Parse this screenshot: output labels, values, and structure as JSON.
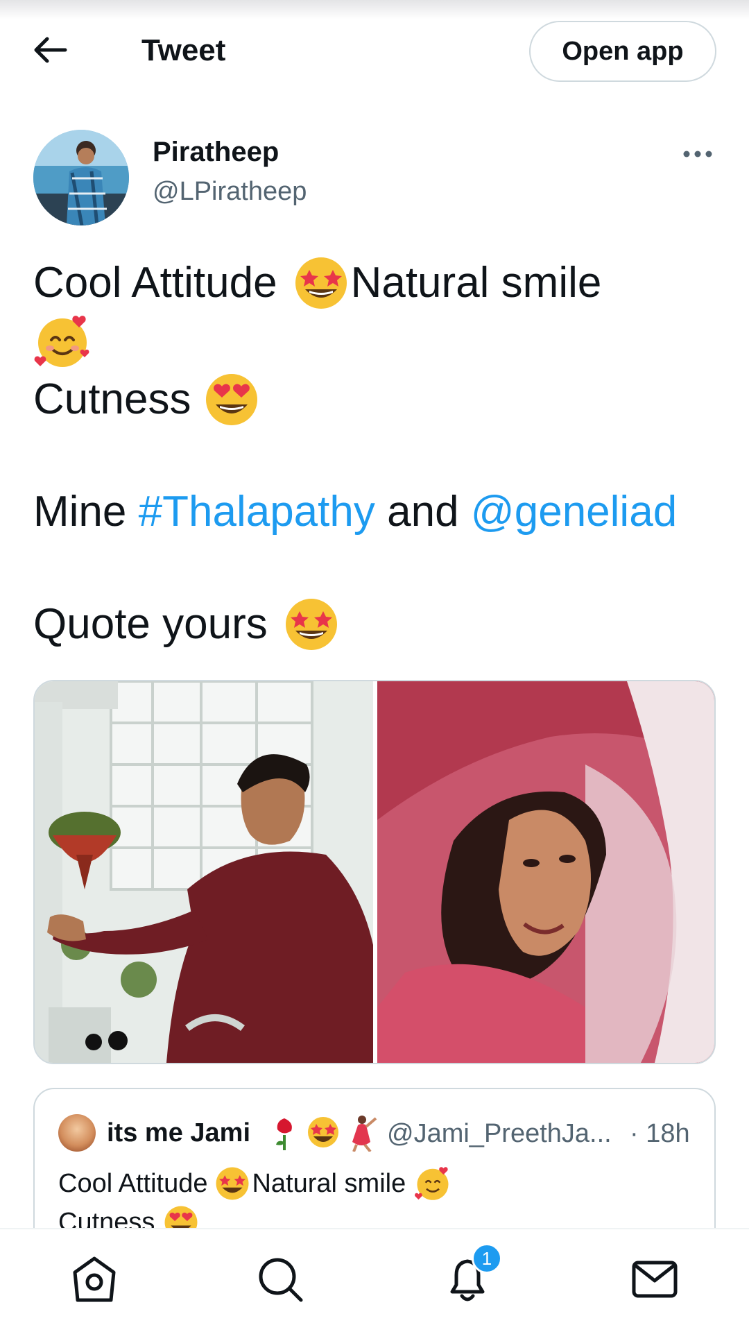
{
  "header": {
    "title": "Tweet",
    "open_app_label": "Open app"
  },
  "author": {
    "name": "Piratheep",
    "handle": "@LPiratheep"
  },
  "tweet": {
    "line1_a": "Cool Attitude",
    "line1_b": "Natural smile",
    "line3": "Cutness",
    "line5_a": "Mine",
    "hashtag": "#Thalapathy",
    "line5_b": "and",
    "mention": "@geneliad",
    "line7": "Quote yours"
  },
  "quoted": {
    "name": "its me Jami",
    "handle": "@Jami_PreethJa...",
    "time": "· 18h",
    "text_a": "Cool Attitude",
    "text_b": "Natural smile",
    "text_c": "Cutness"
  },
  "bottom_nav": {
    "notification_count": "1"
  },
  "colors": {
    "link": "#1d9bf0",
    "secondary_text": "#536471",
    "border": "#cfd9de"
  },
  "icons": [
    "back-arrow-icon",
    "more-icon",
    "home-icon",
    "search-icon",
    "notifications-icon",
    "messages-icon"
  ]
}
